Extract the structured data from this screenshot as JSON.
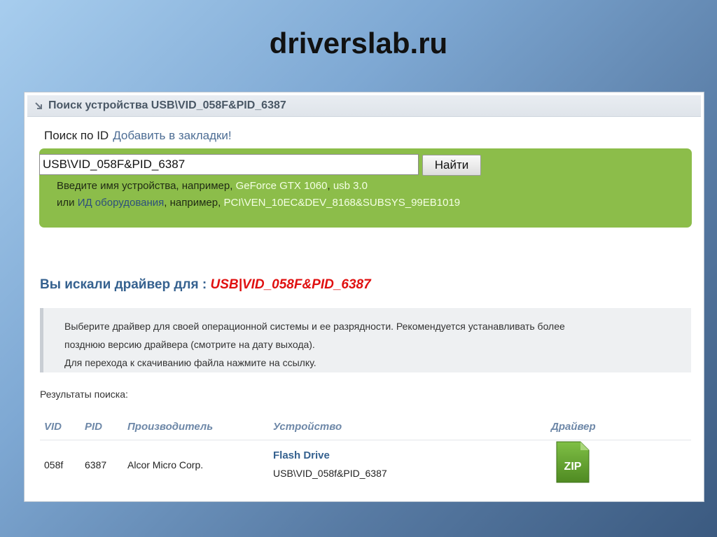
{
  "slide": {
    "title": "driverslab.ru"
  },
  "header": {
    "title": "Поиск устройства USB\\VID_058F&PID_6387"
  },
  "search": {
    "label": "Поиск по ID",
    "bookmark_link": "Добавить в закладки!",
    "input_value": "USB\\VID_058F&PID_6387",
    "button_label": "Найти",
    "hint_line1_prefix": "Введите имя устройства, например,",
    "hint_example1": "GeForce GTX 1060",
    "hint_sep": ",",
    "hint_example2": "usb 3.0",
    "hint_line2_prefix": "или",
    "hint_hardware_link": "ИД оборудования",
    "hint_line2_mid": ", например,",
    "hint_example3": "PCI\\VEN_10EC&DEV_8168&SUBSYS_99EB1019"
  },
  "result": {
    "title_prefix": "Вы искали драйвер для :",
    "query": "USB|VID_058F&PID_6387"
  },
  "info": {
    "line1": "Выберите драйвер для своей операционной системы и ее разрядности. Рекомендуется устанавливать более",
    "line2": "позднюю версию драйвера (смотрите на дату выхода).",
    "line3": "Для перехода к скачиванию файла нажмите на ссылку."
  },
  "results": {
    "label": "Результаты поиска:",
    "columns": [
      "VID",
      "PID",
      "Производитель",
      "Устройство",
      "Драйвер"
    ],
    "rows": [
      {
        "vid": "058f",
        "pid": "6387",
        "vendor": "Alcor Micro Corp.",
        "device_name": "Flash Drive",
        "device_id": "USB\\VID_058f&PID_6387",
        "driver_icon": "zip-file-icon",
        "driver_label": "ZIP"
      }
    ]
  },
  "colors": {
    "green_box": "#8cbd4a",
    "link_blue": "#35618f",
    "query_red": "#e01010",
    "zip_green": "#5c9a2a"
  }
}
